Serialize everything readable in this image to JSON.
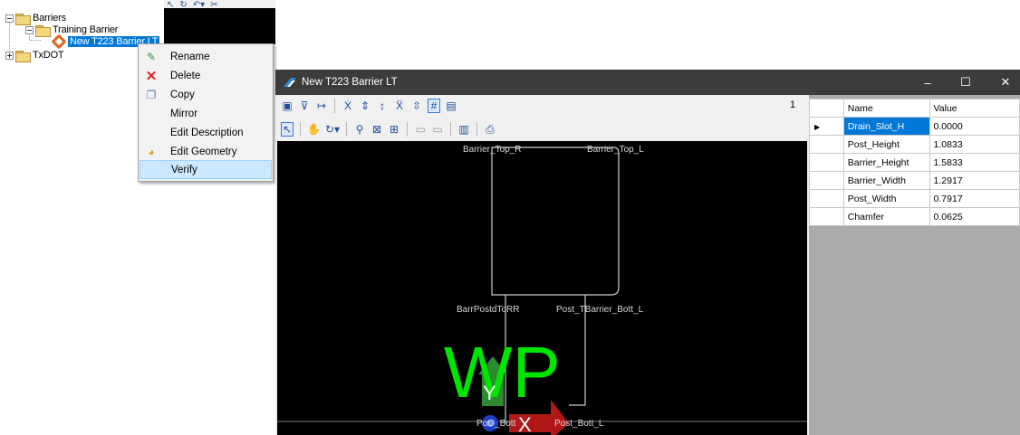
{
  "tree": {
    "items": [
      {
        "label": "Barriers"
      },
      {
        "label": "Training Barrier"
      },
      {
        "label": "New T223 Barrier LT"
      },
      {
        "label": "TxDOT"
      }
    ]
  },
  "context_menu": {
    "items": [
      {
        "label": "Rename",
        "icon": "rename-icon"
      },
      {
        "label": "Delete",
        "icon": "delete-icon"
      },
      {
        "label": "Copy",
        "icon": "copy-icon"
      },
      {
        "label": "Mirror",
        "icon": ""
      },
      {
        "label": "Edit Description",
        "icon": ""
      },
      {
        "label": "Edit Geometry",
        "icon": "edit-geometry-icon"
      },
      {
        "label": "Verify",
        "icon": ""
      }
    ],
    "highlighted": "Verify"
  },
  "window": {
    "title": "New T223 Barrier LT",
    "page_number": "1"
  },
  "canvas_labels": {
    "top_right": "Barrier_Top_R",
    "top_left": "Barrier_Top_L",
    "bott_rr": "BarrPostdToRR",
    "bott_l": "Post_TBarrier_Bott_L",
    "wp": "WP",
    "y_axis": "Y",
    "x_axis": "X",
    "po_bott": "PoO_Bott",
    "post_bott_l": "Post_Bott_L"
  },
  "grid": {
    "headers": {
      "name": "Name",
      "value": "Value"
    },
    "rows": [
      {
        "name": "Drain_Slot_H",
        "value": "0.0000"
      },
      {
        "name": "Post_Height",
        "value": "1.0833"
      },
      {
        "name": "Barrier_Height",
        "value": "1.5833"
      },
      {
        "name": "Barrier_Width",
        "value": "1.2917"
      },
      {
        "name": "Post_Width",
        "value": "0.7917"
      },
      {
        "name": "Chamfer",
        "value": "0.0625"
      }
    ]
  },
  "colors": {
    "accent": "#0078d7",
    "wp": "#00e600",
    "menu_highlight": "#cce8ff",
    "titlebar": "#3c3c3c"
  }
}
